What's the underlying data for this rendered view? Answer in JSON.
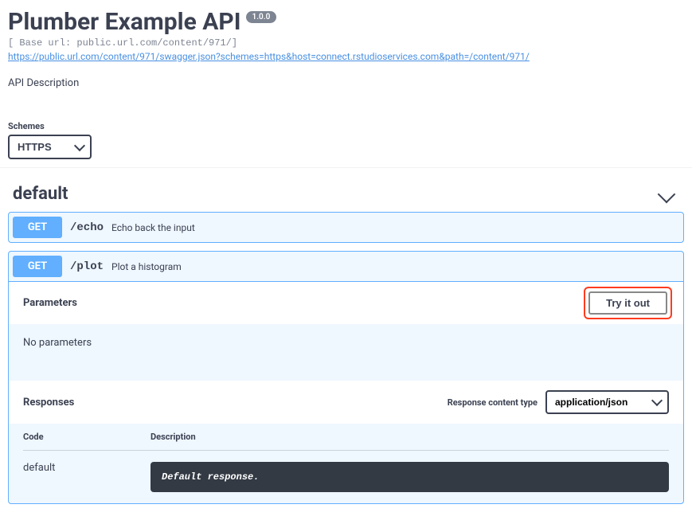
{
  "header": {
    "title": "Plumber Example API",
    "version": "1.0.0",
    "base_url": "[ Base url: public.url.com/content/971/]",
    "spec_link": "https://public.url.com/content/971/swagger.json?schemes=https&host=connect.rstudioservices.com&path=/content/971/",
    "description": "API Description"
  },
  "schemes": {
    "label": "Schemes",
    "selected": "HTTPS"
  },
  "section": {
    "name": "default"
  },
  "ops": {
    "echo": {
      "method": "GET",
      "path": "/echo",
      "desc": "Echo back the input"
    },
    "plot": {
      "method": "GET",
      "path": "/plot",
      "desc": "Plot a histogram",
      "parameters_label": "Parameters",
      "try_label": "Try it out",
      "no_params": "No parameters",
      "responses_label": "Responses",
      "resp_type_label": "Response content type",
      "resp_type_selected": "application/json",
      "col_code": "Code",
      "col_desc": "Description",
      "row_code": "default",
      "row_desc": "Default response."
    }
  }
}
